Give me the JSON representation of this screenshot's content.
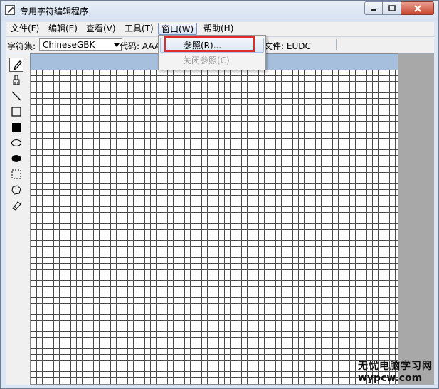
{
  "window": {
    "title": "专用字符编辑程序"
  },
  "menubar": {
    "items": [
      {
        "label": "文件(F)"
      },
      {
        "label": "编辑(E)"
      },
      {
        "label": "查看(V)"
      },
      {
        "label": "工具(T)"
      },
      {
        "label": "窗口(W)"
      },
      {
        "label": "帮助(H)"
      }
    ]
  },
  "toolbar": {
    "charset_label": "字符集:",
    "charset_value": "ChineseGBK",
    "code_label": "代码: AAA",
    "file_label": "文件: EUDC"
  },
  "dropdown": {
    "items": [
      {
        "label": "参照(R)...",
        "enabled": true
      },
      {
        "label": "关闭参照(C)",
        "enabled": false
      }
    ]
  },
  "tools": [
    "pencil-icon",
    "brush-icon",
    "line-icon",
    "hollow-rectangle-icon",
    "filled-rectangle-icon",
    "hollow-ellipse-icon",
    "filled-ellipse-icon",
    "rect-select-icon",
    "freeform-select-icon",
    "eraser-icon"
  ],
  "watermark": {
    "line1": "无忧电脑学习网",
    "line2": "wypcw.com"
  },
  "colors": {
    "highlight_box": "#e02b2b",
    "grid_header": "#a5bfdd",
    "right_panel": "#a8a8a8"
  }
}
